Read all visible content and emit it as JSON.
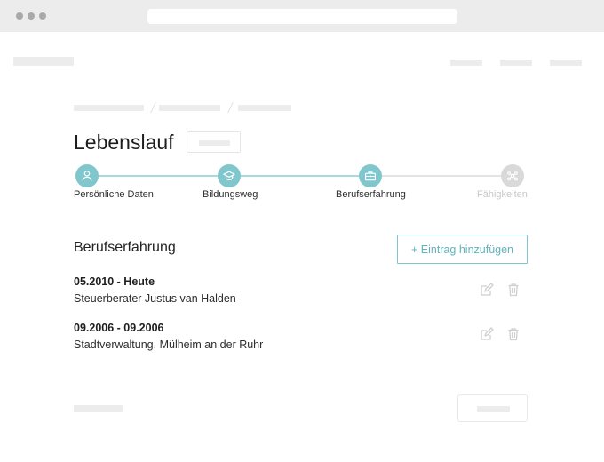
{
  "page": {
    "title": "Lebenslauf"
  },
  "stepper": {
    "accent_color": "#7fc7cd",
    "inactive_color": "#d9d9d9",
    "steps": [
      {
        "label": "Persönliche Daten",
        "icon": "user-icon",
        "state": "completed"
      },
      {
        "label": "Bildungsweg",
        "icon": "graduation-cap-icon",
        "state": "completed"
      },
      {
        "label": "Berufserfahrung",
        "icon": "briefcase-icon",
        "state": "current"
      },
      {
        "label": "Fähigkeiten",
        "icon": "share-nodes-icon",
        "state": "upcoming"
      }
    ]
  },
  "section": {
    "title": "Berufserfahrung",
    "add_button_label": "+ Eintrag hinzufügen"
  },
  "entries": [
    {
      "date": "05.2010 - Heute",
      "description": "Steuerberater Justus van Halden",
      "edit_icon": "edit-icon",
      "delete_icon": "trash-icon"
    },
    {
      "date": "09.2006 - 09.2006",
      "description": "Stadtverwaltung, Mülheim an der Ruhr",
      "edit_icon": "edit-icon",
      "delete_icon": "trash-icon"
    }
  ]
}
